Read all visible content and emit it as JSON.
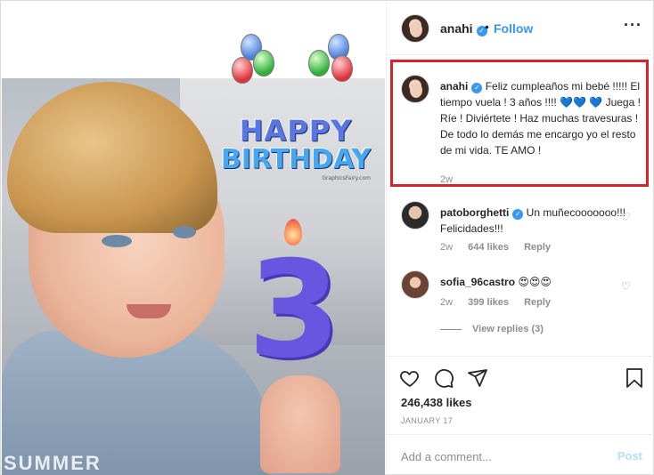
{
  "post": {
    "image": {
      "balloons": [
        "blue",
        "red",
        "green"
      ],
      "greeting_line1": "HAPPY",
      "greeting_line2": "BIRTHDAY",
      "greeting_tag": "GraphicsFairy.com",
      "candle_number": "3",
      "shirt_text": "SUMMER"
    }
  },
  "header": {
    "username": "anahi",
    "dot": "•",
    "follow_label": "Follow",
    "more_icon": "more-horizontal-icon"
  },
  "caption": {
    "username": "anahi",
    "text": "Feliz cumpleaños mi bebé !!!!! El tiempo vuela ! 3 años !!!! 💙💙 💙 Juega ! Ríe ! Diviértete ! Haz muchas travesuras ! De todo lo demás me encargo yo el resto de mi vida. TE AMO !",
    "time": "2w",
    "highlight_color": "#d4252e"
  },
  "comments": [
    {
      "username": "patoborghetti",
      "text": "Un muñecooooooo!!! Felicidades!!!",
      "time": "2w",
      "likes": "644 likes",
      "reply": "Reply"
    },
    {
      "username": "sofia_96castro",
      "text": "😍😍😍",
      "time": "2w",
      "likes": "399 likes",
      "reply": "Reply",
      "view_replies": "View replies (3)"
    }
  ],
  "actions": {
    "like_icon": "heart-outline-icon",
    "comment_icon": "comment-bubble-icon",
    "share_icon": "paper-plane-icon",
    "save_icon": "bookmark-icon"
  },
  "likes_count": "246,438 likes",
  "date": "JANUARY 17",
  "add_comment": {
    "placeholder": "Add a comment...",
    "post_label": "Post"
  },
  "colors": {
    "link_blue": "#3897f0",
    "verified_blue": "#3897f0",
    "muted_text": "#8e8e8e",
    "disabled_post": "#b2dffc"
  }
}
